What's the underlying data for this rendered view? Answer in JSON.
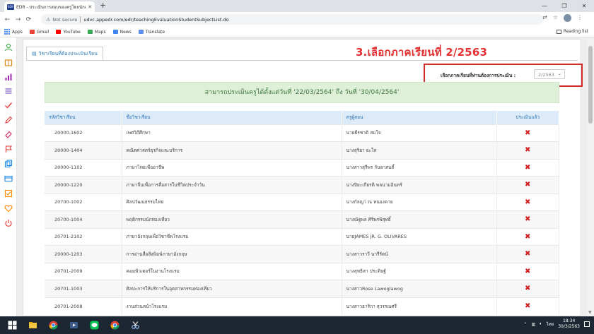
{
  "browser": {
    "tab_title": "EDR - ประเมินการสอนของครูโดยนักเรียน",
    "tab_favicon": "EDR",
    "new_tab": "+",
    "security_label": "Not secure",
    "url": "udvc.appedr.com/edr/teachingEvaluationStudentSubjectList.do",
    "bookmarks": [
      "Apps",
      "Gmail",
      "YouTube",
      "Maps",
      "News",
      "Translate"
    ],
    "reading_list": "Reading list",
    "icons": {
      "back": "back-arrow-icon",
      "forward": "forward-arrow-icon",
      "reload": "reload-icon",
      "warning": "warning-icon"
    }
  },
  "page": {
    "tab_label": "วิชาเรียนที่ต้องประเมินเรียน",
    "annotation": "3.เลือกภาคเรียนที่ 2/2563",
    "semester_label": "เลือกภาคเรียนที่ท่านต้องการประเมิน :",
    "semester_value": "2/2563",
    "banner": "สามารถประเมินครูได้ตั้งแต่วันที่ '22/03/2564' ถึง วันที่ '30/04/2564'",
    "columns": [
      "รหัสวิชาเรียน",
      "ชื่อวิชาเรียน",
      "ครูผู้สอน",
      "ประเมินแล้ว"
    ],
    "rows": [
      {
        "code": "20000-1602",
        "name": "เพศวิถีศึกษา",
        "teacher": "นายธีรชาติ สมใจ",
        "done": "✖"
      },
      {
        "code": "20000-1404",
        "name": "คณิตศาสตร์ธุรกิจและบริการ",
        "teacher": "นางสุริยา ยะใส",
        "done": "✖"
      },
      {
        "code": "20000-1102",
        "name": "ภาษาไทยเพื่ออาชีพ",
        "teacher": "นางสาวสุรีพร กันยาสนธิ์",
        "done": "✖"
      },
      {
        "code": "20000-1220",
        "name": "ภาษาจีนเพื่อการสื่อสารในชีวิตประจำวัน",
        "teacher": "นางปิยะเกียรติ พลนามอินทร์",
        "done": "✖"
      },
      {
        "code": "20700-1002",
        "name": "ศิลปวัฒนธรรมไทย",
        "teacher": "นางกัลญา ณ หนองคาย",
        "done": "✖"
      },
      {
        "code": "20700-1004",
        "name": "พฤติกรรมนักท่องเที่ยว",
        "teacher": "นางณัฐพล ศิริพรพิสุทธิ์",
        "done": "✖"
      },
      {
        "code": "20701-2102",
        "name": "ภาษาอังกฤษเพื่อวิชาชีพโรงแรม",
        "teacher": "นายJAMES JR. G. OLIVARES",
        "done": "✖"
      },
      {
        "code": "20000-1203",
        "name": "การอ่านสื่อสิ่งพิมพ์ภาษาอังกฤษ",
        "teacher": "นางสาวราวี นารีรัตน์",
        "done": "✖"
      },
      {
        "code": "20701-2009",
        "name": "คอมพิวเตอร์ในงานโรงแรม",
        "teacher": "นางสุทธิสา ประดิษฐ์",
        "done": "✖"
      },
      {
        "code": "20701-1003",
        "name": "ศิลปะการให้บริการในอุตสาหกรรมท่องเที่ยว",
        "teacher": "นางสาวRose Lawoglawog",
        "done": "✖"
      },
      {
        "code": "20701-2008",
        "name": "งานส่วนหน้าโรงแรม",
        "teacher": "นางสาวธาริกา สุวรรณศรี",
        "done": "✖"
      }
    ]
  },
  "taskbar": {
    "lang": "ไทย",
    "time": "18:34",
    "date": "30/3/2563"
  },
  "colors": {
    "annotation": "#e53030",
    "highlight_box": "#d42a2a",
    "header_text": "#2b73b6",
    "banner_bg": "#dff0d8",
    "x_mark": "#d01f1f"
  }
}
